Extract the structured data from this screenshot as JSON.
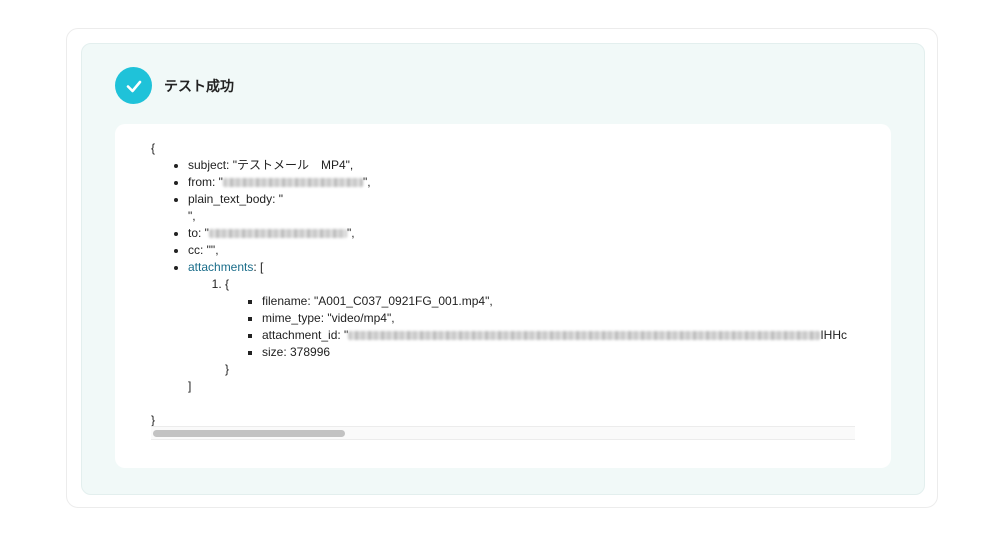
{
  "status": {
    "title": "テスト成功",
    "icon": "check-circle-icon",
    "accent_color": "#1fc2d9"
  },
  "payload": {
    "open_brace": "{",
    "close_brace": "}",
    "subject_line": "subject: \"テストメール　MP4\",",
    "from_prefix": "from: \"",
    "from_suffix": "\",",
    "plain_text_body_line": "plain_text_body: \"",
    "plain_text_body_end": "\",",
    "to_prefix": "to: \"",
    "to_suffix": "\",",
    "cc_line": "cc: \"\",",
    "attachments_key": "attachments",
    "attachments_open": ": [",
    "attachments_close": "]",
    "attachment_item": {
      "open": "{",
      "close": "}",
      "filename_line": "filename: \"A001_C037_0921FG_001.mp4\",",
      "mime_type_line": "mime_type: \"video/mp4\",",
      "attachment_id_prefix": "attachment_id: \"",
      "attachment_id_visible_tail": "IHHc",
      "size_line": "size: 378996"
    }
  }
}
